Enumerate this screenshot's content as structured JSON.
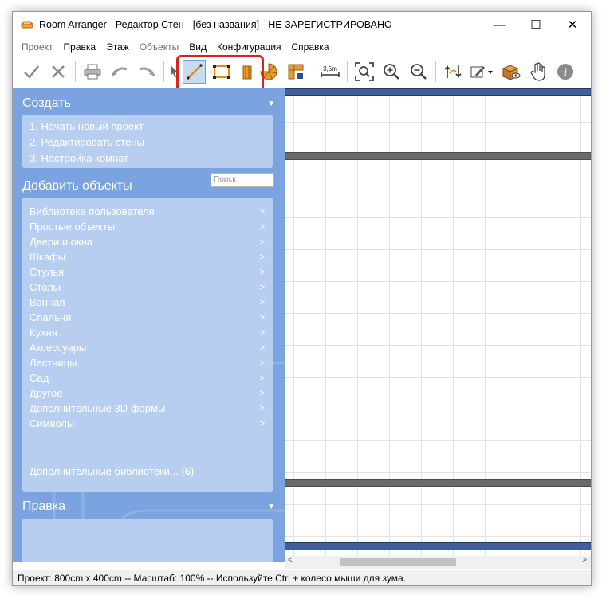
{
  "window": {
    "title": "Room Arranger - Редактор Стен - [без названия] - НЕ ЗАРЕГИСТРИРОВАНО",
    "controls": {
      "minimize": "—",
      "maximize": "☐",
      "close": "✕"
    }
  },
  "menu": {
    "items": [
      {
        "label": "Проект",
        "disabled": true
      },
      {
        "label": "Правка",
        "disabled": false
      },
      {
        "label": "Этаж",
        "disabled": false
      },
      {
        "label": "Объекты",
        "disabled": true
      },
      {
        "label": "Вид",
        "disabled": false
      },
      {
        "label": "Конфигурация",
        "disabled": false
      },
      {
        "label": "Справка",
        "disabled": false
      }
    ]
  },
  "toolbar": {
    "icons": [
      "confirm-check-icon",
      "cancel-x-icon",
      "printer-icon",
      "undo-icon",
      "redo-icon",
      "pointer-icon",
      "draw-wall-icon",
      "draw-rectangle-icon",
      "wall-segment-icon",
      "round-room-icon",
      "corner-room-icon",
      "measure-icon",
      "zoom-fit-icon",
      "zoom-in-icon",
      "zoom-out-icon",
      "rotate-icon",
      "edit-menu-icon",
      "3d-view-icon",
      "hand-tool-icon",
      "info-icon"
    ],
    "measure_label": "3,5m",
    "active_tool": "draw-wall-icon",
    "highlight_color": "#d9241c"
  },
  "sidebar": {
    "create": {
      "title": "Создать",
      "steps": [
        "1. Начать новый проект",
        "2. Редактировать стены",
        "3. Настройка комнат"
      ]
    },
    "add_objects": {
      "title": "Добавить объекты",
      "search_placeholder": "Поиск",
      "categories": [
        "Библиотека пользователя",
        "Простые объекты",
        "Двери и окна",
        "Шкафы",
        "Стулья",
        "Столы",
        "Ванная",
        "Спальня",
        "Кухня",
        "Аксессуары",
        "Лестницы",
        "Сад",
        "Другое",
        "Дополнительные 3D формы",
        "Символы"
      ],
      "extra_libraries": "Дополнительные библиотеки... (6)",
      "arrow": ">"
    },
    "edit": {
      "title": "Правка"
    },
    "collapse_glyph": "▼",
    "colors": {
      "background": "#7aa3df",
      "panel": "#b8cef0"
    }
  },
  "canvas": {
    "wall_blue": "#3f5f9a",
    "wall_gray": "#6a6a6a"
  },
  "scrollbar": {
    "left_arrow": "<",
    "right_arrow": ">"
  },
  "status": {
    "text": "Проект: 800cm x 400cm -- Масштаб: 100% -- Используйте Ctrl + колесо мыши для зума."
  }
}
